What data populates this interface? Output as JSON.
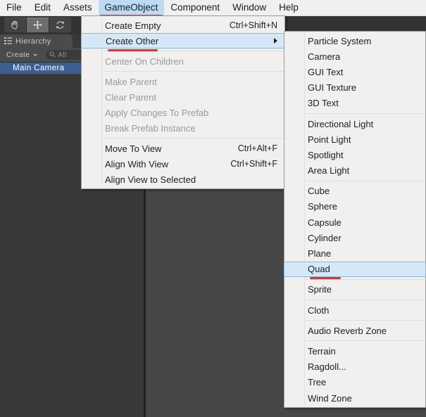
{
  "app": {
    "title": "Unity Editor",
    "accent_highlight": "#b9dcf4",
    "annotation_color": "#e8312b",
    "selection_color": "#3d5f92"
  },
  "menubar": {
    "items": [
      {
        "label": "File",
        "active": false,
        "annotated": false
      },
      {
        "label": "Edit",
        "active": false,
        "annotated": false
      },
      {
        "label": "Assets",
        "active": false,
        "annotated": false
      },
      {
        "label": "GameObject",
        "active": true,
        "annotated": true
      },
      {
        "label": "Component",
        "active": false,
        "annotated": false
      },
      {
        "label": "Window",
        "active": false,
        "annotated": false
      },
      {
        "label": "Help",
        "active": false,
        "annotated": false
      }
    ]
  },
  "toolbar": {
    "tools": [
      {
        "name": "hand-tool",
        "selected": false
      },
      {
        "name": "move-tool",
        "selected": true
      },
      {
        "name": "rotate-tool",
        "selected": false
      }
    ]
  },
  "hierarchy": {
    "tab_label": "Hierarchy",
    "tab_icon": "hierarchy-icon",
    "create_label": "Create",
    "search_placeholder": "All",
    "search_value": "",
    "search_icon": "search-icon",
    "rows": [
      {
        "label": "Main Camera",
        "selected": true
      }
    ]
  },
  "gameobject_menu": {
    "groups": [
      {
        "items": [
          {
            "label": "Create Empty",
            "shortcut": "Ctrl+Shift+N",
            "disabled": false,
            "highlight": false,
            "submenu": false,
            "annotated": false
          },
          {
            "label": "Create Other",
            "shortcut": "",
            "disabled": false,
            "highlight": true,
            "submenu": true,
            "annotated": true
          }
        ]
      },
      {
        "items": [
          {
            "label": "Center On Children",
            "shortcut": "",
            "disabled": true,
            "highlight": false,
            "submenu": false,
            "annotated": false
          }
        ]
      },
      {
        "items": [
          {
            "label": "Make Parent",
            "shortcut": "",
            "disabled": true,
            "highlight": false,
            "submenu": false,
            "annotated": false
          },
          {
            "label": "Clear Parent",
            "shortcut": "",
            "disabled": true,
            "highlight": false,
            "submenu": false,
            "annotated": false
          },
          {
            "label": "Apply Changes To Prefab",
            "shortcut": "",
            "disabled": true,
            "highlight": false,
            "submenu": false,
            "annotated": false
          },
          {
            "label": "Break Prefab Instance",
            "shortcut": "",
            "disabled": true,
            "highlight": false,
            "submenu": false,
            "annotated": false
          }
        ]
      },
      {
        "items": [
          {
            "label": "Move To View",
            "shortcut": "Ctrl+Alt+F",
            "disabled": false,
            "highlight": false,
            "submenu": false,
            "annotated": false
          },
          {
            "label": "Align With View",
            "shortcut": "Ctrl+Shift+F",
            "disabled": false,
            "highlight": false,
            "submenu": false,
            "annotated": false
          },
          {
            "label": "Align View to Selected",
            "shortcut": "",
            "disabled": false,
            "highlight": false,
            "submenu": false,
            "annotated": false
          }
        ]
      }
    ]
  },
  "create_other_submenu": {
    "groups": [
      {
        "items": [
          {
            "label": "Particle System",
            "highlight": false,
            "annotated": false
          },
          {
            "label": "Camera",
            "highlight": false,
            "annotated": false
          },
          {
            "label": "GUI Text",
            "highlight": false,
            "annotated": false
          },
          {
            "label": "GUI Texture",
            "highlight": false,
            "annotated": false
          },
          {
            "label": "3D Text",
            "highlight": false,
            "annotated": false
          }
        ]
      },
      {
        "items": [
          {
            "label": "Directional Light",
            "highlight": false,
            "annotated": false
          },
          {
            "label": "Point Light",
            "highlight": false,
            "annotated": false
          },
          {
            "label": "Spotlight",
            "highlight": false,
            "annotated": false
          },
          {
            "label": "Area Light",
            "highlight": false,
            "annotated": false
          }
        ]
      },
      {
        "items": [
          {
            "label": "Cube",
            "highlight": false,
            "annotated": false
          },
          {
            "label": "Sphere",
            "highlight": false,
            "annotated": false
          },
          {
            "label": "Capsule",
            "highlight": false,
            "annotated": false
          },
          {
            "label": "Cylinder",
            "highlight": false,
            "annotated": false
          },
          {
            "label": "Plane",
            "highlight": false,
            "annotated": false
          },
          {
            "label": "Quad",
            "highlight": true,
            "annotated": true
          }
        ]
      },
      {
        "items": [
          {
            "label": "Sprite",
            "highlight": false,
            "annotated": false
          }
        ]
      },
      {
        "items": [
          {
            "label": "Cloth",
            "highlight": false,
            "annotated": false
          }
        ]
      },
      {
        "items": [
          {
            "label": "Audio Reverb Zone",
            "highlight": false,
            "annotated": false
          }
        ]
      },
      {
        "items": [
          {
            "label": "Terrain",
            "highlight": false,
            "annotated": false
          },
          {
            "label": "Ragdoll...",
            "highlight": false,
            "annotated": false
          },
          {
            "label": "Tree",
            "highlight": false,
            "annotated": false
          },
          {
            "label": "Wind Zone",
            "highlight": false,
            "annotated": false
          }
        ]
      }
    ]
  }
}
